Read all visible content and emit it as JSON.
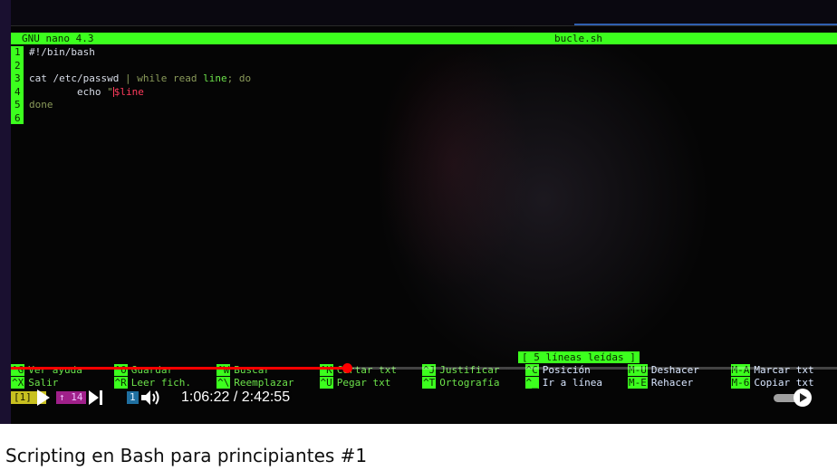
{
  "terminal": {
    "app_name": "GNU nano 4.3",
    "file_name": "bucle.sh",
    "lines": [
      {
        "num": "1",
        "segments": [
          {
            "text": "#!/bin/bash",
            "cls": "c-white"
          }
        ]
      },
      {
        "num": "2",
        "segments": []
      },
      {
        "num": "3",
        "segments": [
          {
            "text": "cat ",
            "cls": "c-white"
          },
          {
            "text": "/etc/passwd",
            "cls": "c-white"
          },
          {
            "text": " | ",
            "cls": "c-olive"
          },
          {
            "text": "while read ",
            "cls": "c-olive"
          },
          {
            "text": "line",
            "cls": "c-green"
          },
          {
            "text": "; ",
            "cls": "c-olive"
          },
          {
            "text": "do",
            "cls": "c-olive"
          }
        ]
      },
      {
        "num": "4",
        "segments": [
          {
            "text": "        echo ",
            "cls": "c-white"
          },
          {
            "text": "\"",
            "cls": "c-olive"
          },
          {
            "text": "CURSOR",
            "cls": "cursor"
          },
          {
            "text": "$line",
            "cls": "c-red"
          }
        ]
      },
      {
        "num": "5",
        "segments": [
          {
            "text": "done",
            "cls": "c-olive"
          }
        ]
      },
      {
        "num": "6",
        "segments": []
      }
    ],
    "status_message": "[ 5 líneas leídas ]",
    "shortcuts_row1": [
      {
        "key": "^G",
        "label": "Ver ayuda"
      },
      {
        "key": "^O",
        "label": "Guardar"
      },
      {
        "key": "^W",
        "label": "Buscar"
      },
      {
        "key": "^K",
        "label": "Cortar txt"
      },
      {
        "key": "^J",
        "label": "Justificar"
      },
      {
        "key": "^C",
        "label": "Posición"
      },
      {
        "key": "M-U",
        "label": "Deshacer"
      },
      {
        "key": "M-A",
        "label": "Marcar txt"
      }
    ],
    "shortcuts_row2": [
      {
        "key": "^X",
        "label": "Salir"
      },
      {
        "key": "^R",
        "label": "Leer fich."
      },
      {
        "key": "^\\",
        "label": "Reemplazar"
      },
      {
        "key": "^U",
        "label": "Pegar txt"
      },
      {
        "key": "^T",
        "label": "Ortografía"
      },
      {
        "key": "^_",
        "label": "Ir a línea"
      },
      {
        "key": "M-E",
        "label": "Rehacer"
      },
      {
        "key": "M-6",
        "label": "Copiar txt"
      }
    ],
    "tmux_segments": [
      {
        "text": "[1] C",
        "bg": "#c8c020",
        "fg": "#1a1a00"
      },
      {
        "text": "↑ 14",
        "bg": "#a0208a",
        "fg": "#f0c0ff"
      },
      {
        "text": "1",
        "bg": "#1f6fa0",
        "fg": "#e0f0ff"
      }
    ]
  },
  "player": {
    "current_time": "1:06:22",
    "separator": " / ",
    "duration": "2:42:55",
    "time_display": "1:06:22 / 2:42:55",
    "progress_fraction": 0.407,
    "colors": {
      "progress": "#ff0000",
      "nano_green": "#3cff1e",
      "background": "#000000"
    },
    "icons": {
      "play": "play-icon",
      "next": "next-icon",
      "volume": "volume-icon",
      "autoplay": "autoplay-toggle-icon"
    }
  },
  "video": {
    "title": "Scripting en Bash para principiantes #1"
  }
}
